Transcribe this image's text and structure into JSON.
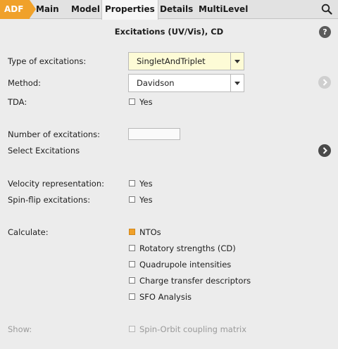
{
  "tabs": [
    {
      "label": "ADF"
    },
    {
      "label": "Main"
    },
    {
      "label": "Model"
    },
    {
      "label": "Properties"
    },
    {
      "label": "Details"
    },
    {
      "label": "MultiLevel"
    }
  ],
  "panel": {
    "title": "Excitations (UV/Vis), CD",
    "help_symbol": "?"
  },
  "fields": {
    "type_label": "Type of excitations:",
    "type_value": "SingletAndTriplet",
    "method_label": "Method:",
    "method_value": "Davidson",
    "tda_label": "TDA:",
    "tda_option": "Yes",
    "num_exc_label": "Number of excitations:",
    "num_exc_value": "",
    "select_exc_label": "Select Excitations",
    "velocity_label": "Velocity representation:",
    "velocity_option": "Yes",
    "spinflip_label": "Spin-flip excitations:",
    "spinflip_option": "Yes",
    "calculate_label": "Calculate:",
    "calc_options": [
      {
        "label": "NTOs",
        "checked": true
      },
      {
        "label": "Rotatory strengths (CD)",
        "checked": false
      },
      {
        "label": "Quadrupole intensities",
        "checked": false
      },
      {
        "label": "Charge transfer descriptors",
        "checked": false
      },
      {
        "label": "SFO Analysis",
        "checked": false
      }
    ],
    "show_label": "Show:",
    "show_option": "Spin-Orbit coupling matrix"
  },
  "colors": {
    "accent": "#f0a12a",
    "type_select_bg": "#fdfbd6",
    "panel_bg": "#ececec"
  },
  "icons": {
    "search": "search-icon",
    "help": "help-icon",
    "nav_method": "chevron-right-icon",
    "nav_select": "chevron-right-icon"
  }
}
